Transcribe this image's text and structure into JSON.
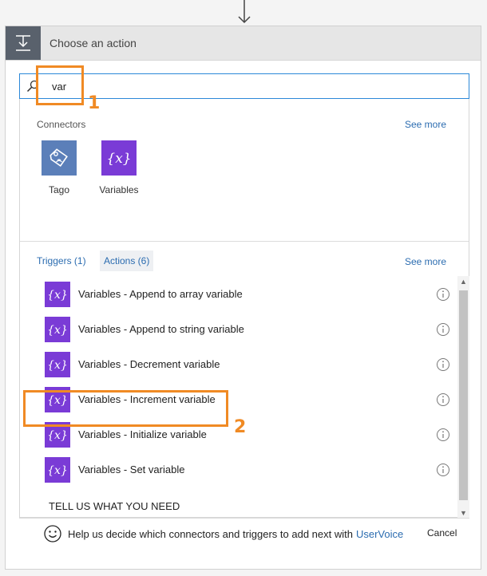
{
  "header": {
    "title": "Choose an action",
    "icon": "download-to-tray-icon"
  },
  "search": {
    "value": "var",
    "placeholder": ""
  },
  "connectors": {
    "label": "Connectors",
    "see_more": "See more",
    "items": [
      {
        "label": "Tago",
        "icon": "tago-tag-icon",
        "color": "#5b7fb9"
      },
      {
        "label": "Variables",
        "icon": "variable-braces-icon",
        "color": "#7a3bd6"
      }
    ]
  },
  "tabs": {
    "items": [
      {
        "label": "Triggers (1)",
        "active": false
      },
      {
        "label": "Actions (6)",
        "active": true
      }
    ],
    "see_more": "See more"
  },
  "actions": [
    {
      "label": "Variables - Append to array variable"
    },
    {
      "label": "Variables - Append to string variable"
    },
    {
      "label": "Variables - Decrement variable"
    },
    {
      "label": "Variables - Increment variable"
    },
    {
      "label": "Variables - Initialize variable"
    },
    {
      "label": "Variables - Set variable"
    }
  ],
  "feedback": {
    "title": "TELL US WHAT YOU NEED",
    "text": "Help us decide which connectors and triggers to add next with",
    "link": "UserVoice"
  },
  "footer": {
    "cancel": "Cancel"
  },
  "annotations": [
    {
      "label": "1"
    },
    {
      "label": "2"
    }
  ],
  "colors": {
    "accent": "#2b88d8",
    "variables": "#7a3bd6",
    "annotation": "#f08a24",
    "header_icon_bg": "#59616c"
  }
}
